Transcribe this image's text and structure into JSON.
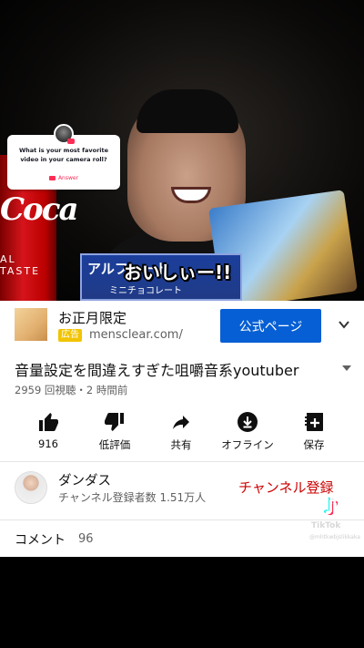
{
  "video": {
    "caption": "おいしぃー!!",
    "snack_brand": "アルフォート",
    "snack_sub": "ミニチョコレート",
    "cola_text": "Coca",
    "cola_sub": "AL TASTE"
  },
  "question_sticker": {
    "text": "What is your most favorite video in your camera roll?",
    "answer": "Answer"
  },
  "ad": {
    "title": "お正月限定",
    "badge": "広告",
    "url": "mensclear.com/",
    "cta": "公式ページ"
  },
  "video_info": {
    "title": "音量設定を間違えすぎた咀嚼音系youtuber",
    "meta": "2959 回視聴・2 時間前"
  },
  "actions": [
    {
      "label": "916",
      "icon": "thumbs-up-icon"
    },
    {
      "label": "低評価",
      "icon": "thumbs-down-icon"
    },
    {
      "label": "共有",
      "icon": "share-icon"
    },
    {
      "label": "オフライン",
      "icon": "download-icon"
    },
    {
      "label": "保存",
      "icon": "add-to-playlist-icon"
    }
  ],
  "channel": {
    "name": "ダンダス",
    "subscribers": "チャンネル登録者数 1.51万人",
    "subscribe_label": "チャンネル登録"
  },
  "comments": {
    "label": "コメント",
    "count": "96"
  },
  "watermark": {
    "name": "TikTok",
    "handle": "@mhtkwbjslikkaka"
  },
  "colors": {
    "cta_blue": "#065fd4",
    "subscribe_red": "#cc0000",
    "ad_badge": "#f2c400",
    "tiktok_pink": "#fe2c55"
  }
}
